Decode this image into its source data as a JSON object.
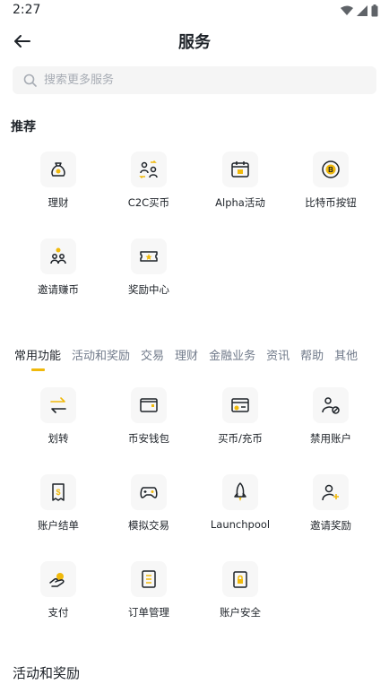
{
  "status_bar": {
    "time": "2:27"
  },
  "header": {
    "title": "服务"
  },
  "search": {
    "placeholder": "搜索更多服务"
  },
  "recommended": {
    "title": "推荐",
    "items": [
      {
        "label": "理财",
        "icon": "money-bag-icon"
      },
      {
        "label": "C2C买币",
        "icon": "users-exchange-icon"
      },
      {
        "label": "Alpha活动",
        "icon": "calendar-icon"
      },
      {
        "label": "比特币按钮",
        "icon": "bitcoin-coin-icon"
      },
      {
        "label": "邀请赚币",
        "icon": "invite-earn-icon"
      },
      {
        "label": "奖励中心",
        "icon": "reward-ticket-icon"
      }
    ]
  },
  "tabs": [
    "常用功能",
    "活动和奖励",
    "交易",
    "理财",
    "金融业务",
    "资讯",
    "帮助",
    "其他"
  ],
  "common": {
    "items": [
      {
        "label": "划转",
        "icon": "transfer-arrows-icon"
      },
      {
        "label": "币安钱包",
        "icon": "wallet-icon"
      },
      {
        "label": "买币/充币",
        "icon": "buy-deposit-icon"
      },
      {
        "label": "禁用账户",
        "icon": "disable-account-icon"
      },
      {
        "label": "账户结单",
        "icon": "statement-icon"
      },
      {
        "label": "模拟交易",
        "icon": "gamepad-icon"
      },
      {
        "label": "Launchpool",
        "icon": "rocket-icon"
      },
      {
        "label": "邀请奖励",
        "icon": "invite-user-icon"
      },
      {
        "label": "支付",
        "icon": "pay-icon"
      },
      {
        "label": "订单管理",
        "icon": "order-list-icon"
      },
      {
        "label": "账户安全",
        "icon": "lock-shield-icon"
      }
    ]
  },
  "activity_section": {
    "title": "活动和奖励"
  },
  "colors": {
    "accent": "#F0B90B",
    "text": "#1E2329",
    "muted": "#707A8A",
    "icon_bg": "#F7F7F7"
  }
}
